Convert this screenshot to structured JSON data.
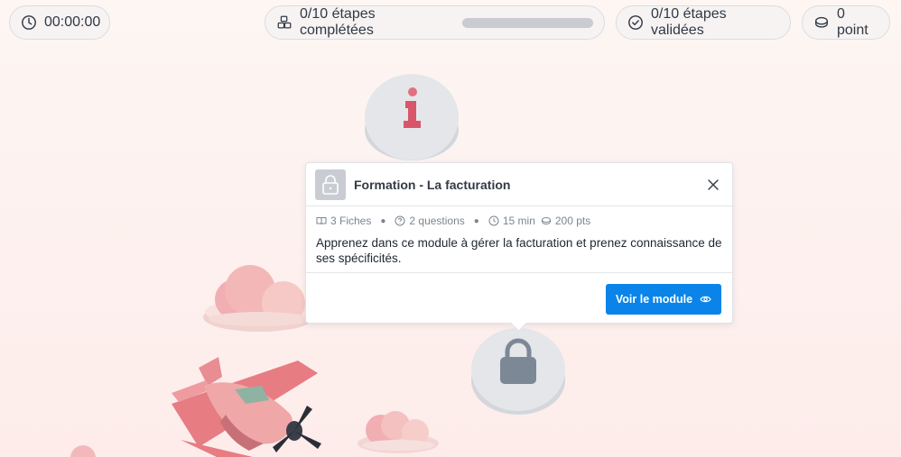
{
  "topbar": {
    "timer": {
      "icon": "clock-icon",
      "value": "00:00:00"
    },
    "steps_completed": {
      "icon": "blocks-icon",
      "label": "0/10 étapes complétées",
      "progress": 0
    },
    "steps_validated": {
      "icon": "check-circle-icon",
      "label": "0/10 étapes validées"
    },
    "points": {
      "icon": "coin-icon",
      "label": "0 point"
    }
  },
  "nodes": {
    "info": {
      "icon": "info-icon"
    },
    "locked": {
      "icon": "lock-icon"
    }
  },
  "popup": {
    "thumb_icon": "lock-icon",
    "title": "Formation - La facturation",
    "meta": {
      "sheets": "3 Fiches",
      "questions": "2 questions",
      "duration": "15 min",
      "points": "200 pts"
    },
    "description": "Apprenez dans ce module à gérer la facturation et prenez connaissance de ses spécificités.",
    "cta_label": "Voir le module",
    "colors": {
      "cta": "#0a84e9"
    }
  }
}
